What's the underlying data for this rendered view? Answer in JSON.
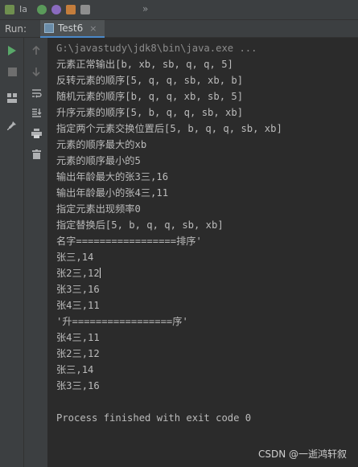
{
  "toolbar": {
    "more_label": "»"
  },
  "run_panel": {
    "label": "Run:",
    "tab_label": "Test6",
    "tab_close": "×"
  },
  "console": {
    "command": "G:\\javastudy\\jdk8\\bin\\java.exe ...",
    "lines": [
      "元素正常输出[b, xb, sb, q, q, 5]",
      "反转元素的顺序[5, q, q, sb, xb, b]",
      "随机元素的顺序[b, q, q, xb, sb, 5]",
      "升序元素的顺序[5, b, q, q, sb, xb]",
      "指定两个元素交换位置后[5, b, q, q, sb, xb]",
      "元素的顺序最大的xb",
      "元素的顺序最小的5",
      "输出年龄最大的张3三,16",
      "输出年龄最小的张4三,11",
      "指定元素出现频率0",
      "指定替换后[5, b, q, q, sb, xb]",
      "名字=================排序'",
      "张三,14",
      "张2三,12",
      "张3三,16",
      "张4三,11",
      "'升=================序'",
      "张4三,11",
      "张2三,12",
      "张三,14",
      "张3三,16",
      "",
      "Process finished with exit code 0"
    ]
  },
  "watermark": "CSDN @一逝鸿轩叙",
  "colors": {
    "background": "#2b2b2b",
    "panel": "#3c3f41",
    "run_green": "#59a869",
    "text": "#bbbbbb",
    "tab_accent": "#4a88c7"
  }
}
